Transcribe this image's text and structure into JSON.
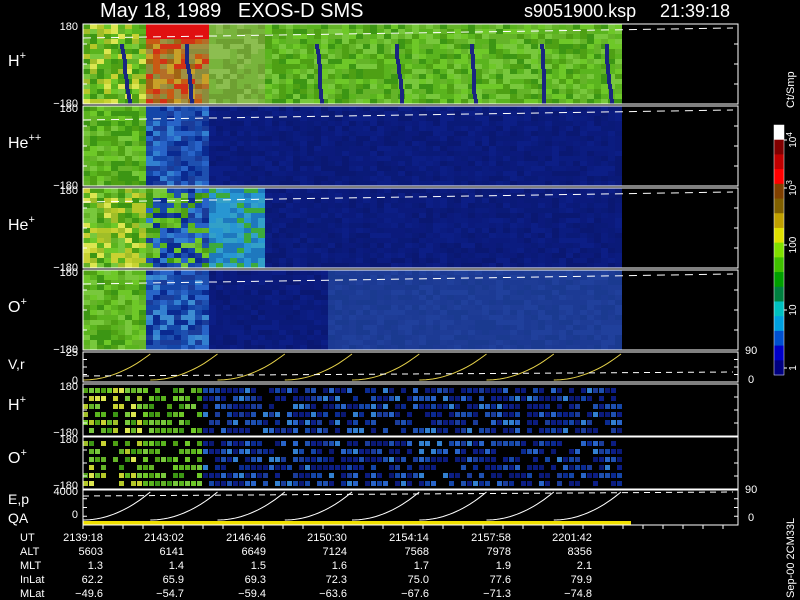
{
  "header": {
    "title": "May 18, 1989   EXOS-D SMS",
    "file": "s9051900.ksp",
    "time": "21:39:18"
  },
  "colorbar": {
    "unit_label": "Ct/Smp",
    "ticks": [
      "1",
      "10",
      "100",
      "10",
      "10"
    ],
    "tick_exponents": [
      "",
      "",
      "",
      "3",
      "4"
    ],
    "colors": [
      "#000080",
      "#0000c8",
      "#0050d0",
      "#00a0e0",
      "#00c0c0",
      "#008040",
      "#00a000",
      "#40c000",
      "#80e000",
      "#e0e000",
      "#c0a000",
      "#806000",
      "#804000",
      "#ff0000",
      "#c00000",
      "#800000",
      "#ffffff"
    ]
  },
  "panels": [
    {
      "species": "H",
      "charge": "+",
      "ymax": "180",
      "ymin": "−180"
    },
    {
      "species": "He",
      "charge": "++",
      "ymax": "180",
      "ymin": "−180"
    },
    {
      "species": "He",
      "charge": "+",
      "ymax": "180",
      "ymin": "−180"
    },
    {
      "species": "O",
      "charge": "+",
      "ymax": "180",
      "ymin": "−180"
    }
  ],
  "vr_panel": {
    "label": "V,r",
    "ymax": "25",
    "ymin": "0",
    "right_top": "90",
    "right_bottom": "0"
  },
  "small_panels": [
    {
      "species": "H",
      "charge": "+",
      "ymax": "180",
      "ymin": "−180"
    },
    {
      "species": "O",
      "charge": "+",
      "ymax": "180",
      "ymin": "−180"
    }
  ],
  "ep_panel": {
    "label": "E,p",
    "label2": "QA",
    "ymax": "4000",
    "ymin": "0",
    "right_top": "90",
    "right_bottom": "0"
  },
  "side_label": "Sep-00 2CM33L",
  "footer": {
    "row_labels": [
      "UT",
      "ALT",
      "MLT",
      "InLat",
      "MLat"
    ],
    "columns": [
      {
        "UT": "2139:18",
        "ALT": "5603",
        "MLT": "1.3",
        "InLat": "62.2",
        "MLat": "−49.6"
      },
      {
        "UT": "2143:02",
        "ALT": "6141",
        "MLT": "1.4",
        "InLat": "65.9",
        "MLat": "−54.7"
      },
      {
        "UT": "2146:46",
        "ALT": "6649",
        "MLT": "1.5",
        "InLat": "69.3",
        "MLat": "−59.4"
      },
      {
        "UT": "2150:30",
        "ALT": "7124",
        "MLT": "1.6",
        "InLat": "72.3",
        "MLat": "−63.6"
      },
      {
        "UT": "2154:14",
        "ALT": "7568",
        "MLT": "1.7",
        "InLat": "75.0",
        "MLat": "−67.6"
      },
      {
        "UT": "2157:58",
        "ALT": "7978",
        "MLT": "1.9",
        "InLat": "77.6",
        "MLat": "−71.3"
      },
      {
        "UT": "2201:42",
        "ALT": "8356",
        "MLT": "2.1",
        "InLat": "79.9",
        "MLat": "−74.8"
      }
    ]
  }
}
